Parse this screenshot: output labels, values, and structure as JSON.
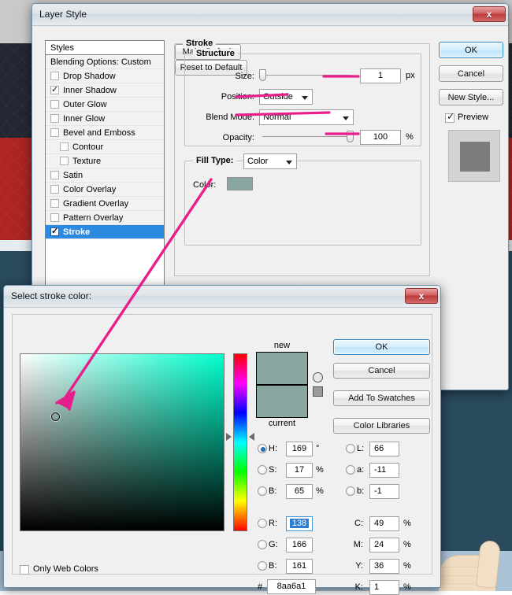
{
  "desktop": {
    "thumb_illustration": "thumbs-up-hand"
  },
  "layer_style": {
    "title": "Layer Style",
    "close_label": "x",
    "styles_header": "Styles",
    "styles": [
      {
        "label": "Blending Options: Custom",
        "checkbox": false,
        "has_checkbox": false,
        "indent": false,
        "selected": false
      },
      {
        "label": "Drop Shadow",
        "checkbox": false,
        "has_checkbox": true,
        "indent": false,
        "selected": false
      },
      {
        "label": "Inner Shadow",
        "checkbox": true,
        "has_checkbox": true,
        "indent": false,
        "selected": false
      },
      {
        "label": "Outer Glow",
        "checkbox": false,
        "has_checkbox": true,
        "indent": false,
        "selected": false
      },
      {
        "label": "Inner Glow",
        "checkbox": false,
        "has_checkbox": true,
        "indent": false,
        "selected": false
      },
      {
        "label": "Bevel and Emboss",
        "checkbox": false,
        "has_checkbox": true,
        "indent": false,
        "selected": false
      },
      {
        "label": "Contour",
        "checkbox": false,
        "has_checkbox": true,
        "indent": true,
        "selected": false
      },
      {
        "label": "Texture",
        "checkbox": false,
        "has_checkbox": true,
        "indent": true,
        "selected": false
      },
      {
        "label": "Satin",
        "checkbox": false,
        "has_checkbox": true,
        "indent": false,
        "selected": false
      },
      {
        "label": "Color Overlay",
        "checkbox": false,
        "has_checkbox": true,
        "indent": false,
        "selected": false
      },
      {
        "label": "Gradient Overlay",
        "checkbox": false,
        "has_checkbox": true,
        "indent": false,
        "selected": false
      },
      {
        "label": "Pattern Overlay",
        "checkbox": false,
        "has_checkbox": true,
        "indent": false,
        "selected": false
      },
      {
        "label": "Stroke",
        "checkbox": true,
        "has_checkbox": true,
        "indent": false,
        "selected": true
      }
    ],
    "stroke_legend": "Stroke",
    "structure_legend": "Structure",
    "size_label": "Size:",
    "size_value": "1",
    "size_unit": "px",
    "position_label": "Position:",
    "position_value": "Outside",
    "blend_mode_label": "Blend Mode:",
    "blend_mode_value": "Normal",
    "opacity_label": "Opacity:",
    "opacity_value": "100",
    "opacity_unit": "%",
    "fill_type_label": "Fill Type:",
    "fill_type_value": "Color",
    "color_label": "Color:",
    "color_swatch": "#8aa6a1",
    "make_default": "Make Default",
    "reset_to_default": "Reset to Default",
    "ok": "OK",
    "cancel": "Cancel",
    "new_style": "New Style...",
    "preview_label": "Preview",
    "preview_checked": true
  },
  "color_picker": {
    "title": "Select stroke color:",
    "close_label": "x",
    "new_label": "new",
    "current_label": "current",
    "new_color": "#8aa6a1",
    "current_color": "#8aa6a1",
    "ok": "OK",
    "cancel": "Cancel",
    "add_to_swatches": "Add To Swatches",
    "color_libraries": "Color Libraries",
    "only_web_colors_label": "Only Web Colors",
    "only_web_colors_checked": false,
    "hash_label": "#",
    "hex_value": "8aa6a1",
    "selected_radio": "H",
    "fields": [
      {
        "key": "H",
        "label": "H:",
        "value": "169",
        "unit": "°",
        "radio": true,
        "selected": true
      },
      {
        "key": "S",
        "label": "S:",
        "value": "17",
        "unit": "%",
        "radio": true,
        "selected": false
      },
      {
        "key": "B",
        "label": "B:",
        "value": "65",
        "unit": "%",
        "radio": true,
        "selected": false
      },
      {
        "key": "R",
        "label": "R:",
        "value": "138",
        "unit": "",
        "radio": true,
        "selected": false,
        "focused": true
      },
      {
        "key": "G",
        "label": "G:",
        "value": "166",
        "unit": "",
        "radio": true,
        "selected": false
      },
      {
        "key": "B2",
        "label": "B:",
        "value": "161",
        "unit": "",
        "radio": true,
        "selected": false
      }
    ],
    "fields_right": [
      {
        "key": "L",
        "label": "L:",
        "value": "66",
        "unit": "",
        "radio": true
      },
      {
        "key": "a",
        "label": "a:",
        "value": "-11",
        "unit": "",
        "radio": true
      },
      {
        "key": "b",
        "label": "b:",
        "value": "-1",
        "unit": "",
        "radio": true
      },
      {
        "key": "C",
        "label": "C:",
        "value": "49",
        "unit": "%",
        "radio": false
      },
      {
        "key": "M",
        "label": "M:",
        "value": "24",
        "unit": "%",
        "radio": false
      },
      {
        "key": "Y",
        "label": "Y:",
        "value": "36",
        "unit": "%",
        "radio": false
      },
      {
        "key": "K",
        "label": "K:",
        "value": "1",
        "unit": "%",
        "radio": false
      }
    ],
    "hue_degrees": 169,
    "sat_percent": 17,
    "bright_percent": 65,
    "hue_pure_color": "#00ffcd"
  },
  "annotations": {
    "highlight_color": "#e61f8c",
    "strokes": "underlines-and-arrow"
  }
}
